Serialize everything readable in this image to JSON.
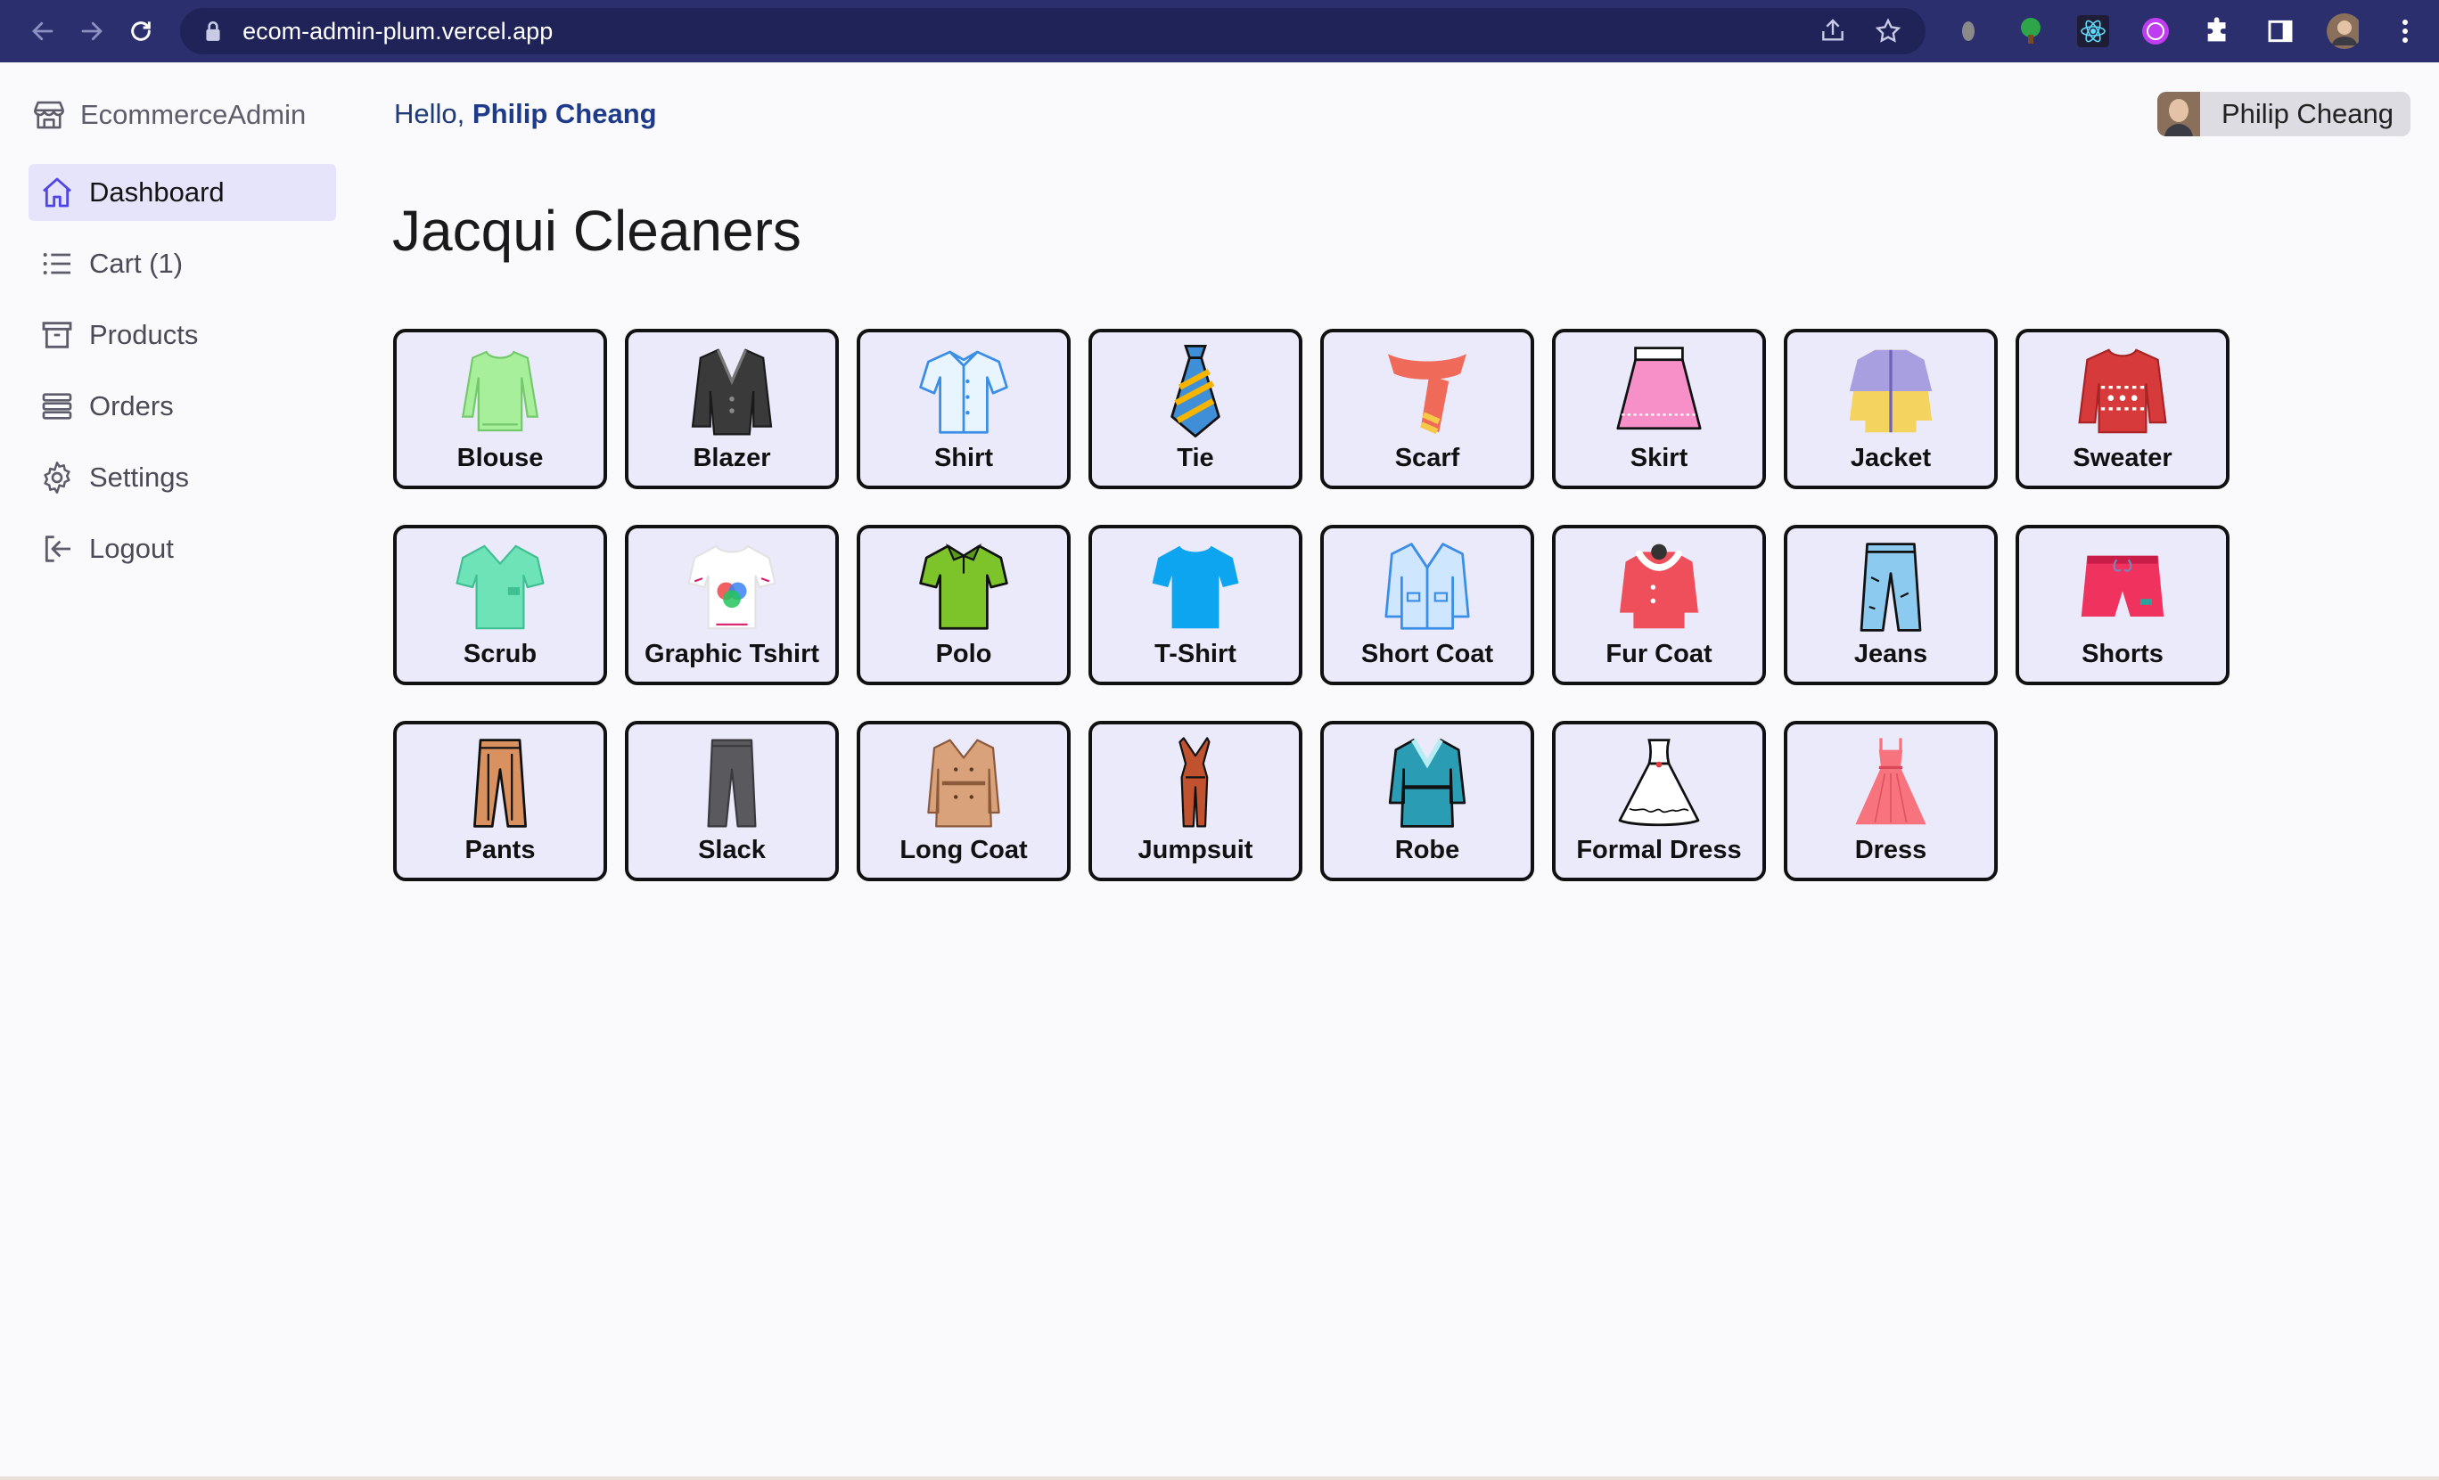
{
  "browser": {
    "url": "ecom-admin-plum.vercel.app"
  },
  "sidebar": {
    "brand": "EcommerceAdmin",
    "items": [
      {
        "label": "Dashboard",
        "icon": "home-icon",
        "active": true
      },
      {
        "label": "Cart (1)",
        "icon": "list-icon"
      },
      {
        "label": "Products",
        "icon": "archive-icon"
      },
      {
        "label": "Orders",
        "icon": "stack-icon"
      },
      {
        "label": "Settings",
        "icon": "gear-icon"
      },
      {
        "label": "Logout",
        "icon": "logout-icon"
      }
    ]
  },
  "header": {
    "greeting": "Hello,",
    "user": "Philip Cheang",
    "chip_name": "Philip Cheang"
  },
  "main": {
    "title": "Jacqui Cleaners",
    "products": [
      {
        "label": "Blouse",
        "icon": "blouse-icon",
        "color": "#a8ef9c"
      },
      {
        "label": "Blazer",
        "icon": "blazer-icon",
        "color": "#3a3a3a"
      },
      {
        "label": "Shirt",
        "icon": "shirt-icon",
        "color": "#cfe9ff"
      },
      {
        "label": "Tie",
        "icon": "tie-icon",
        "color": "#3f8fd8"
      },
      {
        "label": "Scarf",
        "icon": "scarf-icon",
        "color": "#f06a5a"
      },
      {
        "label": "Skirt",
        "icon": "skirt-icon",
        "color": "#f78fc8"
      },
      {
        "label": "Jacket",
        "icon": "jacket-icon",
        "color": "#f4d35e"
      },
      {
        "label": "Sweater",
        "icon": "sweater-icon",
        "color": "#d63a3a"
      },
      {
        "label": "Scrub",
        "icon": "scrub-icon",
        "color": "#6fe3b8"
      },
      {
        "label": "Graphic Tshirt",
        "icon": "graphic-tshirt-icon",
        "color": "#ffffff"
      },
      {
        "label": "Polo",
        "icon": "polo-icon",
        "color": "#7cc42a"
      },
      {
        "label": "T-Shirt",
        "icon": "tshirt-icon",
        "color": "#0ea5f0"
      },
      {
        "label": "Short Coat",
        "icon": "short-coat-icon",
        "color": "#cfe6ff"
      },
      {
        "label": "Fur Coat",
        "icon": "fur-coat-icon",
        "color": "#ef4f5a"
      },
      {
        "label": "Jeans",
        "icon": "jeans-icon",
        "color": "#8ccaf0"
      },
      {
        "label": "Shorts",
        "icon": "shorts-icon",
        "color": "#f0325e"
      },
      {
        "label": "Pants",
        "icon": "pants-icon",
        "color": "#d9925f"
      },
      {
        "label": "Slack",
        "icon": "slack-icon",
        "color": "#5a5a5e"
      },
      {
        "label": "Long Coat",
        "icon": "long-coat-icon",
        "color": "#d9a27a"
      },
      {
        "label": "Jumpsuit",
        "icon": "jumpsuit-icon",
        "color": "#c0522f"
      },
      {
        "label": "Robe",
        "icon": "robe-icon",
        "color": "#2a9db5"
      },
      {
        "label": "Formal Dress",
        "icon": "formal-dress-icon",
        "color": "#ffffff"
      },
      {
        "label": "Dress",
        "icon": "dress-icon",
        "color": "#f7737d"
      }
    ]
  }
}
